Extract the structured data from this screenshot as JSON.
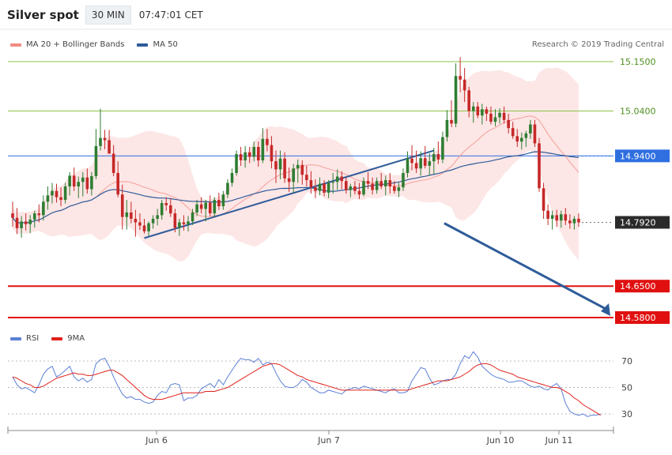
{
  "header": {
    "title": "Silver spot",
    "interval": "30 MIN",
    "time": "07:47:01 CET"
  },
  "legend": {
    "ma20": {
      "label": "MA 20 + Bollinger Bands",
      "color": "#f28b82"
    },
    "ma50": {
      "label": "MA 50",
      "color": "#2e5c9a"
    }
  },
  "credit": "Research © 2019 Trading Central",
  "rsi_legend": {
    "rsi": {
      "label": "RSI",
      "color": "#5b7fd6"
    },
    "ma9": {
      "label": "9MA",
      "color": "#e0201b"
    }
  },
  "colors": {
    "up": "#2f7d32",
    "down": "#c62828",
    "band": "#fde3e3",
    "support": "#e01010",
    "resistance": "#8bc34a",
    "pivot": "#2f6fe0"
  },
  "chart_data": [
    {
      "type": "candlestick",
      "x_ticks": [
        "Jun 6",
        "Jun 7",
        "Jun 10",
        "Jun 11"
      ],
      "ylim": [
        14.552,
        15.172
      ],
      "levels": [
        {
          "value": 15.15,
          "label": "15.1500",
          "kind": "resistance"
        },
        {
          "value": 15.04,
          "label": "15.0400",
          "kind": "resistance"
        },
        {
          "value": 14.94,
          "label": "14.9400",
          "kind": "pivot"
        },
        {
          "value": 14.792,
          "label": "14.7920",
          "kind": "last"
        },
        {
          "value": 14.65,
          "label": "14.6500",
          "kind": "support"
        },
        {
          "value": 14.58,
          "label": "14.5800",
          "kind": "support"
        }
      ],
      "trendline": {
        "from": [
          30,
          14.757
        ],
        "to": [
          96,
          14.952
        ]
      },
      "forecast_arrow": {
        "from": [
          98,
          14.79
        ],
        "to": [
          107,
          14.58
        ]
      },
      "ohlc": [
        [
          14.812,
          14.838,
          14.782,
          14.802
        ],
        [
          14.802,
          14.824,
          14.766,
          14.779
        ],
        [
          14.779,
          14.806,
          14.758,
          14.794
        ],
        [
          14.794,
          14.812,
          14.774,
          14.788
        ],
        [
          14.788,
          14.808,
          14.768,
          14.798
        ],
        [
          14.798,
          14.818,
          14.78,
          14.812
        ],
        [
          14.812,
          14.832,
          14.792,
          14.808
        ],
        [
          14.808,
          14.852,
          14.796,
          14.838
        ],
        [
          14.838,
          14.872,
          14.82,
          14.852
        ],
        [
          14.852,
          14.88,
          14.834,
          14.862
        ],
        [
          14.862,
          14.878,
          14.836,
          14.848
        ],
        [
          14.848,
          14.87,
          14.828,
          14.842
        ],
        [
          14.842,
          14.88,
          14.834,
          14.872
        ],
        [
          14.872,
          14.904,
          14.852,
          14.896
        ],
        [
          14.896,
          14.914,
          14.862,
          14.872
        ],
        [
          14.872,
          14.894,
          14.846,
          14.882
        ],
        [
          14.882,
          14.904,
          14.85,
          14.892
        ],
        [
          14.892,
          14.912,
          14.856,
          14.866
        ],
        [
          14.866,
          14.904,
          14.852,
          14.895
        ],
        [
          14.895,
          15.0,
          14.888,
          14.962
        ],
        [
          14.962,
          15.045,
          14.952,
          14.98
        ],
        [
          14.98,
          14.998,
          14.955,
          14.975
        ],
        [
          14.975,
          14.998,
          14.956,
          14.945
        ],
        [
          14.945,
          14.964,
          14.895,
          14.902
        ],
        [
          14.902,
          14.928,
          14.848,
          14.854
        ],
        [
          14.854,
          14.876,
          14.776,
          14.804
        ],
        [
          14.804,
          14.842,
          14.776,
          14.814
        ],
        [
          14.814,
          14.838,
          14.79,
          14.8
        ],
        [
          14.8,
          14.82,
          14.76,
          14.792
        ],
        [
          14.792,
          14.812,
          14.775,
          14.785
        ],
        [
          14.785,
          14.8,
          14.767,
          14.772
        ],
        [
          14.772,
          14.794,
          14.762,
          14.79
        ],
        [
          14.79,
          14.808,
          14.778,
          14.8
        ],
        [
          14.8,
          14.822,
          14.785,
          14.808
        ],
        [
          14.808,
          14.842,
          14.798,
          14.835
        ],
        [
          14.835,
          14.848,
          14.818,
          14.83
        ],
        [
          14.83,
          14.846,
          14.804,
          14.812
        ],
        [
          14.812,
          14.822,
          14.77,
          14.78
        ],
        [
          14.78,
          14.8,
          14.762,
          14.792
        ],
        [
          14.792,
          14.808,
          14.774,
          14.788
        ],
        [
          14.788,
          14.806,
          14.772,
          14.794
        ],
        [
          14.794,
          14.822,
          14.786,
          14.814
        ],
        [
          14.814,
          14.842,
          14.806,
          14.832
        ],
        [
          14.832,
          14.848,
          14.812,
          14.822
        ],
        [
          14.822,
          14.842,
          14.794,
          14.836
        ],
        [
          14.836,
          14.852,
          14.806,
          14.812
        ],
        [
          14.812,
          14.848,
          14.804,
          14.842
        ],
        [
          14.842,
          14.858,
          14.82,
          14.828
        ],
        [
          14.828,
          14.862,
          14.82,
          14.854
        ],
        [
          14.854,
          14.888,
          14.846,
          14.88
        ],
        [
          14.88,
          14.912,
          14.872,
          14.902
        ],
        [
          14.902,
          14.952,
          14.896,
          14.944
        ],
        [
          14.944,
          14.96,
          14.918,
          14.93
        ],
        [
          14.93,
          14.962,
          14.914,
          14.948
        ],
        [
          14.948,
          14.96,
          14.924,
          14.938
        ],
        [
          14.938,
          14.972,
          14.928,
          14.96
        ],
        [
          14.96,
          14.972,
          14.916,
          14.93
        ],
        [
          14.93,
          15.002,
          14.924,
          14.978
        ],
        [
          14.978,
          15.0,
          14.95,
          14.964
        ],
        [
          14.964,
          14.984,
          14.912,
          14.928
        ],
        [
          14.928,
          14.952,
          14.88,
          14.91
        ],
        [
          14.91,
          14.952,
          14.888,
          14.934
        ],
        [
          14.934,
          14.948,
          14.88,
          14.89
        ],
        [
          14.89,
          14.914,
          14.86,
          14.882
        ],
        [
          14.882,
          14.922,
          14.858,
          14.912
        ],
        [
          14.912,
          14.932,
          14.88,
          14.92
        ],
        [
          14.92,
          14.93,
          14.876,
          14.898
        ],
        [
          14.898,
          14.918,
          14.872,
          14.886
        ],
        [
          14.886,
          14.906,
          14.856,
          14.87
        ],
        [
          14.87,
          14.888,
          14.846,
          14.862
        ],
        [
          14.862,
          14.892,
          14.852,
          14.878
        ],
        [
          14.878,
          14.886,
          14.85,
          14.858
        ],
        [
          14.858,
          14.886,
          14.846,
          14.88
        ],
        [
          14.88,
          14.902,
          14.856,
          14.882
        ],
        [
          14.882,
          14.91,
          14.864,
          14.894
        ],
        [
          14.894,
          14.906,
          14.866,
          14.884
        ],
        [
          14.884,
          14.892,
          14.856,
          14.864
        ],
        [
          14.864,
          14.878,
          14.848,
          14.872
        ],
        [
          14.872,
          14.884,
          14.854,
          14.862
        ],
        [
          14.862,
          14.88,
          14.844,
          14.854
        ],
        [
          14.854,
          14.892,
          14.85,
          14.884
        ],
        [
          14.884,
          14.904,
          14.866,
          14.878
        ],
        [
          14.878,
          14.892,
          14.854,
          14.864
        ],
        [
          14.864,
          14.892,
          14.856,
          14.884
        ],
        [
          14.884,
          14.902,
          14.866,
          14.872
        ],
        [
          14.872,
          14.896,
          14.852,
          14.886
        ],
        [
          14.886,
          14.902,
          14.856,
          14.872
        ],
        [
          14.872,
          14.884,
          14.856,
          14.862
        ],
        [
          14.862,
          14.88,
          14.848,
          14.87
        ],
        [
          14.87,
          14.912,
          14.862,
          14.902
        ],
        [
          14.902,
          14.95,
          14.892,
          14.934
        ],
        [
          14.934,
          14.964,
          14.908,
          14.924
        ],
        [
          14.924,
          14.952,
          14.902,
          14.912
        ],
        [
          14.912,
          14.95,
          14.896,
          14.935
        ],
        [
          14.935,
          14.962,
          14.912,
          14.918
        ],
        [
          14.918,
          14.946,
          14.896,
          14.928
        ],
        [
          14.928,
          14.958,
          14.9,
          14.944
        ],
        [
          14.944,
          14.972,
          14.922,
          14.932
        ],
        [
          14.932,
          14.994,
          14.924,
          14.982
        ],
        [
          14.982,
          15.042,
          14.972,
          15.02
        ],
        [
          15.02,
          15.064,
          15.004,
          15.012
        ],
        [
          15.012,
          15.146,
          15.004,
          15.118
        ],
        [
          15.118,
          15.16,
          15.082,
          15.11
        ],
        [
          15.11,
          15.136,
          15.06,
          15.086
        ],
        [
          15.086,
          15.094,
          15.026,
          15.04
        ],
        [
          15.04,
          15.06,
          15.014,
          15.05
        ],
        [
          15.05,
          15.06,
          15.024,
          15.03
        ],
        [
          15.03,
          15.056,
          15.01,
          15.044
        ],
        [
          15.044,
          15.05,
          15.018,
          15.034
        ],
        [
          15.034,
          15.05,
          15.01,
          15.016
        ],
        [
          15.016,
          15.044,
          15.006,
          15.026
        ],
        [
          15.026,
          15.046,
          15.012,
          15.036
        ],
        [
          15.036,
          15.05,
          15.012,
          15.02
        ],
        [
          15.02,
          15.034,
          14.99,
          15.002
        ],
        [
          15.002,
          15.016,
          14.978,
          14.984
        ],
        [
          14.984,
          15.0,
          14.96,
          14.972
        ],
        [
          14.972,
          14.992,
          14.954,
          14.98
        ],
        [
          14.98,
          14.996,
          14.96,
          14.99
        ],
        [
          14.99,
          15.02,
          14.978,
          15.01
        ],
        [
          15.01,
          15.02,
          14.96,
          14.968
        ],
        [
          14.968,
          14.98,
          14.86,
          14.868
        ],
        [
          14.868,
          14.88,
          14.8,
          14.818
        ],
        [
          14.818,
          14.832,
          14.786,
          14.8
        ],
        [
          14.8,
          14.818,
          14.776,
          14.808
        ],
        [
          14.808,
          14.82,
          14.782,
          14.796
        ],
        [
          14.796,
          14.818,
          14.78,
          14.81
        ],
        [
          14.81,
          14.824,
          14.786,
          14.796
        ],
        [
          14.796,
          14.81,
          14.778,
          14.79
        ],
        [
          14.79,
          14.806,
          14.776,
          14.8
        ],
        [
          14.8,
          14.812,
          14.782,
          14.792
        ]
      ]
    },
    {
      "type": "line",
      "title": "RSI",
      "ylim": [
        20,
        80
      ],
      "y_ticks": [
        30,
        50,
        70
      ],
      "series": [
        {
          "name": "RSI",
          "values": [
            58,
            52,
            49,
            50,
            48,
            46,
            52,
            60,
            64,
            66,
            58,
            60,
            63,
            66,
            58,
            55,
            57,
            54,
            56,
            68,
            71,
            72,
            66,
            58,
            51,
            45,
            42,
            43,
            41,
            41,
            39,
            38,
            39,
            44,
            47,
            46,
            52,
            53,
            52,
            40,
            42,
            42,
            44,
            49,
            51,
            53,
            50,
            56,
            52,
            58,
            63,
            68,
            72,
            71,
            71,
            69,
            72,
            67,
            69,
            68,
            61,
            55,
            51,
            50,
            50,
            52,
            56,
            54,
            50,
            48,
            46,
            46,
            48,
            47,
            46,
            45,
            48,
            49,
            50,
            49,
            51,
            50,
            49,
            48,
            47,
            46,
            48,
            49,
            46,
            46,
            47,
            55,
            60,
            65,
            64,
            57,
            52,
            53,
            55,
            56,
            56,
            60,
            68,
            74,
            72,
            77,
            73,
            66,
            63,
            60,
            58,
            57,
            56,
            54,
            54,
            55,
            55,
            53,
            51,
            50,
            51,
            49,
            48,
            51,
            53,
            49,
            38,
            32,
            30,
            29,
            30,
            28,
            29,
            29,
            30
          ]
        },
        {
          "name": "9MA",
          "values": [
            58,
            57,
            55,
            53,
            52,
            50,
            50,
            51,
            53,
            55,
            57,
            58,
            59,
            60,
            61,
            60,
            60,
            59,
            59,
            60,
            61,
            62,
            63,
            63,
            61,
            59,
            56,
            53,
            50,
            47,
            44,
            42,
            41,
            41,
            41,
            42,
            43,
            44,
            45,
            46,
            46,
            46,
            46,
            46,
            47,
            47,
            47,
            48,
            49,
            50,
            52,
            54,
            56,
            58,
            60,
            62,
            64,
            66,
            67,
            68,
            68,
            67,
            65,
            63,
            61,
            59,
            58,
            56,
            55,
            54,
            53,
            52,
            51,
            50,
            49,
            48,
            48,
            48,
            48,
            48,
            48,
            48,
            48,
            48,
            48,
            48,
            48,
            48,
            48,
            48,
            48,
            49,
            50,
            51,
            52,
            53,
            54,
            55,
            55,
            55,
            56,
            57,
            58,
            60,
            62,
            65,
            67,
            68,
            68,
            67,
            65,
            63,
            62,
            61,
            60,
            58,
            57,
            56,
            55,
            54,
            53,
            52,
            51,
            50,
            50,
            49,
            47,
            45,
            42,
            40,
            37,
            35,
            33,
            31,
            29
          ]
        }
      ]
    }
  ]
}
